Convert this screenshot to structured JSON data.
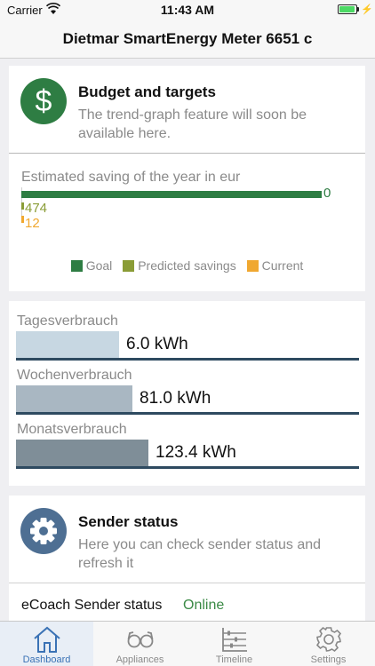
{
  "status_bar": {
    "carrier": "Carrier",
    "time": "11:43 AM"
  },
  "nav": {
    "title": "Dietmar SmartEnergy Meter 6651 c"
  },
  "budget": {
    "title": "Budget and targets",
    "description": "The trend-graph feature will soon be available here.",
    "icon": "dollar-icon",
    "icon_glyph": "$"
  },
  "chart_data": {
    "type": "bar",
    "orientation": "horizontal",
    "title": "Estimated saving of the year in eur",
    "series": [
      {
        "name": "Goal",
        "value": 0,
        "label": "0",
        "color": "#2e7d43"
      },
      {
        "name": "Predicted savings",
        "value": 474,
        "label": "474",
        "color": "#8a9c36"
      },
      {
        "name": "Current",
        "value": 12,
        "label": "12",
        "color": "#f0a830"
      }
    ],
    "legend_position": "bottom",
    "grid": false
  },
  "meters": [
    {
      "label": "Tagesverbrauch",
      "value": "6.0 kWh",
      "fill": 0.3,
      "color": "#c7d7e2"
    },
    {
      "label": "Wochenverbrauch",
      "value": "81.0 kWh",
      "fill": 0.34,
      "color": "#a9b7c2"
    },
    {
      "label": "Monatsverbrauch",
      "value": "123.4 kWh",
      "fill": 0.385,
      "color": "#7f8e98"
    }
  ],
  "sender": {
    "title": "Sender status",
    "description": "Here you can check sender status and refresh it",
    "icon": "gear-icon",
    "status_label": "eCoach Sender status",
    "status_value": "Online",
    "status_color": "#3b8a46"
  },
  "tabs": [
    {
      "label": "Dashboard",
      "icon": "home-icon",
      "active": true
    },
    {
      "label": "Appliances",
      "icon": "glasses-icon",
      "active": false
    },
    {
      "label": "Timeline",
      "icon": "timeline-icon",
      "active": false
    },
    {
      "label": "Settings",
      "icon": "settings-icon",
      "active": false
    }
  ]
}
